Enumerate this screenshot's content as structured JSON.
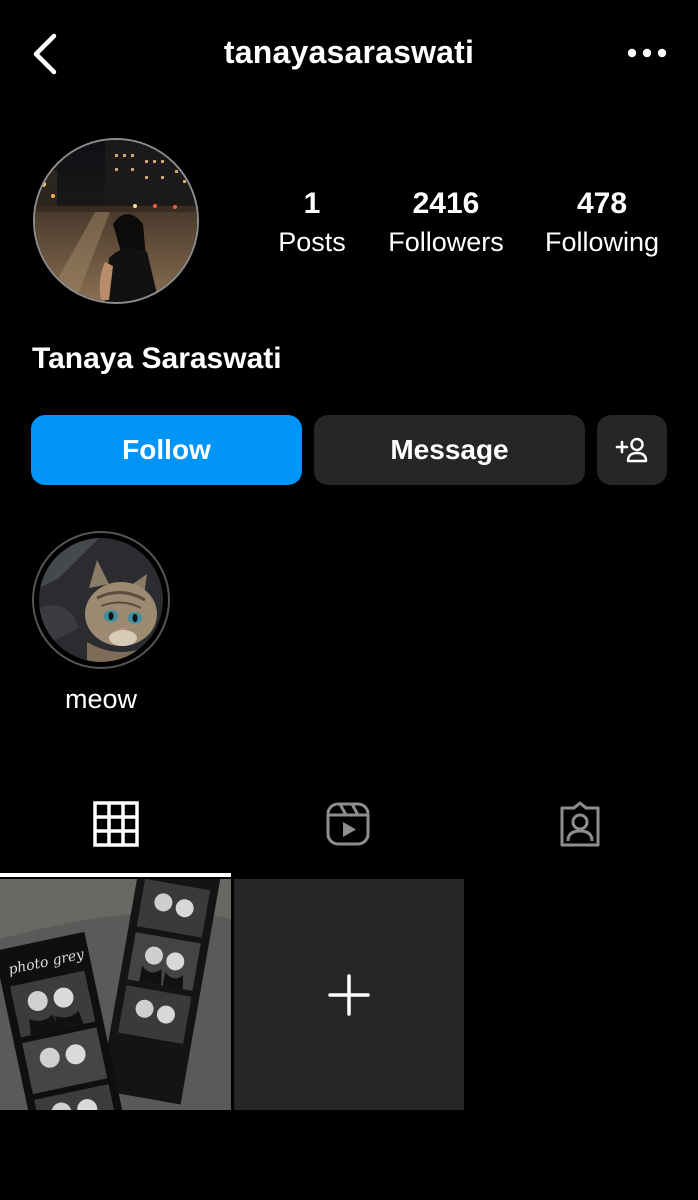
{
  "header": {
    "username": "tanayasaraswati",
    "back_icon": "chevron-left-icon",
    "more_icon": "more-horizontal-icon"
  },
  "profile": {
    "display_name": "Tanaya Saraswati",
    "stats": [
      {
        "value": "1",
        "label": "Posts"
      },
      {
        "value": "2416",
        "label": "Followers"
      },
      {
        "value": "478",
        "label": "Following"
      }
    ]
  },
  "actions": {
    "follow_label": "Follow",
    "message_label": "Message",
    "add_user_icon": "add-user-icon",
    "follow_color": "#0095f6",
    "secondary_color": "#262626"
  },
  "highlights": [
    {
      "label": "meow"
    }
  ],
  "tabs": [
    {
      "icon": "grid-icon",
      "active": true
    },
    {
      "icon": "reels-icon",
      "active": false
    },
    {
      "icon": "tagged-icon",
      "active": false
    }
  ],
  "posts": {
    "add_icon": "plus-icon"
  }
}
